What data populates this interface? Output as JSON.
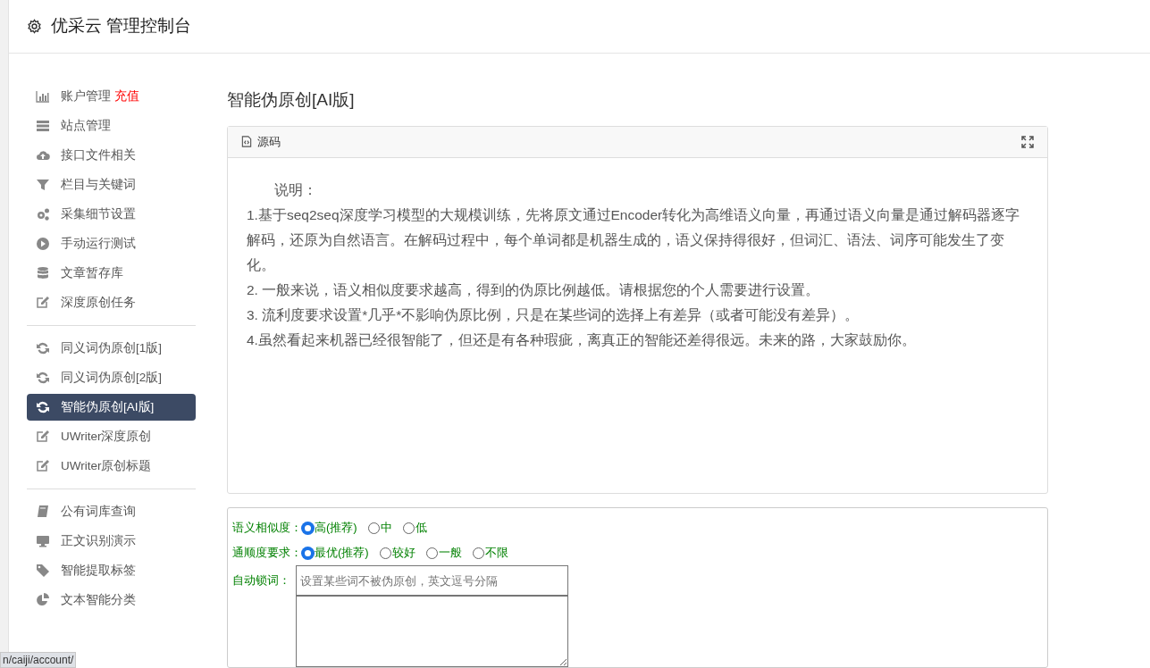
{
  "header": {
    "title": "优采云 管理控制台"
  },
  "sidebar": {
    "groups": [
      [
        {
          "label": "账户管理",
          "badge": "充值",
          "selected": false
        },
        {
          "label": "站点管理",
          "selected": false
        },
        {
          "label": "接口文件相关",
          "selected": false
        },
        {
          "label": "栏目与关键词",
          "selected": false
        },
        {
          "label": "采集细节设置",
          "selected": false
        },
        {
          "label": "手动运行测试",
          "selected": false
        },
        {
          "label": "文章暂存库",
          "selected": false
        },
        {
          "label": "深度原创任务",
          "selected": false
        }
      ],
      [
        {
          "label": "同义词伪原创[1版]",
          "selected": false
        },
        {
          "label": "同义词伪原创[2版]",
          "selected": false
        },
        {
          "label": "智能伪原创[AI版]",
          "selected": true
        },
        {
          "label": "UWriter深度原创",
          "selected": false
        },
        {
          "label": "UWriter原创标题",
          "selected": false
        }
      ],
      [
        {
          "label": "公有词库查询",
          "selected": false
        },
        {
          "label": "正文识别演示",
          "selected": false
        },
        {
          "label": "智能提取标签",
          "selected": false
        },
        {
          "label": "文本智能分类",
          "selected": false
        }
      ]
    ]
  },
  "content": {
    "title": "智能伪原创[AI版]",
    "editor": {
      "tab": "源码",
      "paragraphs": [
        "说明：",
        "1.基于seq2seq深度学习模型的大规模训练，先将原文通过Encoder转化为高维语义向量，再通过语义向量是通过解码器逐字解码，还原为自然语言。在解码过程中，每个单词都是机器生成的，语义保持得很好，但词汇、语法、词序可能发生了变化。",
        "2. 一般来说，语义相似度要求越高，得到的伪原比例越低。请根据您的个人需要进行设置。",
        "3. 流利度要求设置*几乎*不影响伪原比例，只是在某些词的选择上有差异（或者可能没有差异）。",
        "4.虽然看起来机器已经很智能了，但还是有各种瑕疵，离真正的智能还差得很远。未来的路，大家鼓励你。"
      ]
    },
    "form": {
      "rows": [
        {
          "kind": "radio",
          "label": "语义相似度：",
          "options": [
            {
              "label": "高(推荐)",
              "selected": true
            },
            {
              "label": "中",
              "selected": false
            },
            {
              "label": "低",
              "selected": false
            }
          ]
        },
        {
          "kind": "radio",
          "label": "通顺度要求：",
          "options": [
            {
              "label": "最优(推荐)",
              "selected": true
            },
            {
              "label": "较好",
              "selected": false
            },
            {
              "label": "一般",
              "selected": false
            },
            {
              "label": "不限",
              "selected": false
            }
          ]
        },
        {
          "kind": "input",
          "label": "自动锁词：",
          "placeholder": "设置某些词不被伪原创，英文逗号分隔"
        },
        {
          "kind": "textarea"
        }
      ]
    }
  },
  "status_bar": {
    "url": "n/caiji/account/"
  }
}
